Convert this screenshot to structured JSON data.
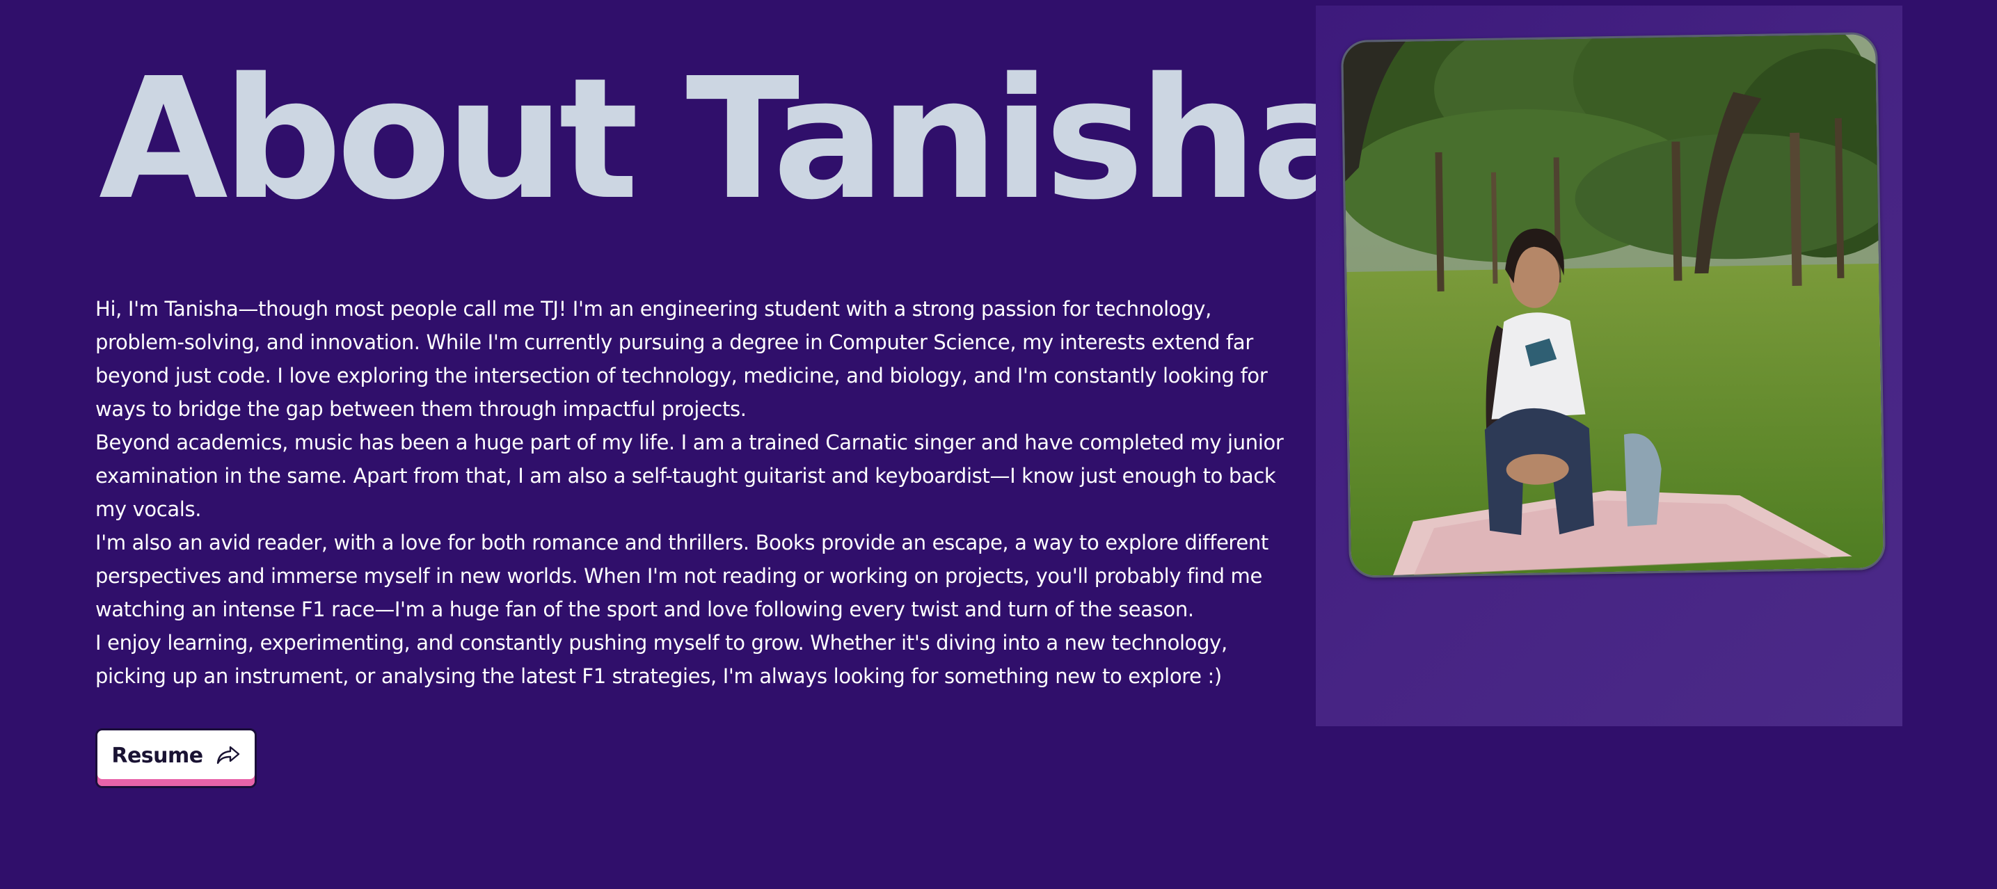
{
  "heading": {
    "title": "About Tanisha"
  },
  "bio": {
    "paragraphs": [
      "Hi, I'm Tanisha—though most people call me TJ! I'm an engineering student with a strong passion for technology, problem-solving, and innovation. While I'm currently pursuing a degree in Computer Science, my interests extend far beyond just code. I love exploring the intersection of technology, medicine, and biology, and I'm constantly looking for ways to bridge the gap between them through impactful projects.",
      "Beyond academics, music has been a huge part of my life. I am a trained Carnatic singer and have completed my junior examination in the same. Apart from that, I am also a self-taught guitarist and keyboardist—I know just enough to back my vocals.",
      "I'm also an avid reader, with a love for both romance and thrillers. Books provide an escape, a way to explore different perspectives and immerse myself in new worlds. When I'm not reading or working on projects, you'll probably find me watching an intense F1 race—I'm a huge fan of the sport and love following every twist and turn of the season.",
      "I enjoy learning, experimenting, and constantly pushing myself to grow. Whether it's diving into a new technology, picking up an instrument, or analysing the latest F1 strategies, I'm always looking for something new to explore :)"
    ]
  },
  "actions": {
    "resume_label": "Resume",
    "resume_icon": "share-arrow-icon"
  },
  "colors": {
    "background": "#300f6b",
    "heading": "#ccd6e2",
    "button_accent": "#e763a9"
  }
}
